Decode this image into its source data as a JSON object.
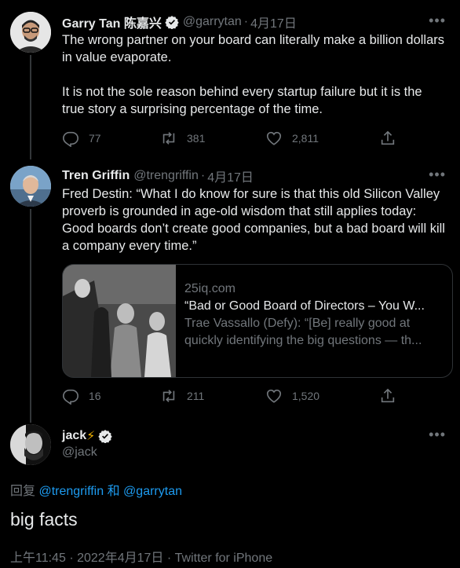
{
  "tweets": [
    {
      "name": "Garry Tan 陈嘉兴",
      "handle": "@garrytan",
      "dot": "·",
      "date": "4月17日",
      "text": "The wrong partner on your board can literally make a billion dollars in value evaporate.\n\nIt is not the sole reason behind every startup failure but it is the true story a surprising percentage of the time.",
      "replies": "77",
      "retweets": "381",
      "likes": "2,811"
    },
    {
      "name": "Tren Griffin",
      "handle": "@trengriffin",
      "dot": "·",
      "date": "4月17日",
      "text": "Fred Destin: “What I do know for sure is that this old Silicon Valley proverb is grounded in age-old wisdom that still applies today: Good boards don’t create good companies, but a bad board will kill a company every time.”",
      "card": {
        "domain": "25iq.com",
        "title": "“Bad or Good Board of Directors – You W...",
        "description": " Trae Vassallo (Defy): “[Be] really good at quickly identifying the big questions — th..."
      },
      "replies": "16",
      "retweets": "211",
      "likes": "1,520"
    }
  ],
  "main_tweet": {
    "name": "jack",
    "emoji": "⚡",
    "handle": "@jack",
    "reply_prefix": "回复",
    "reply_user1": "@trengriffin",
    "reply_and": "和",
    "reply_user2": "@garrytan",
    "text": "big facts",
    "time": "上午11:45",
    "dot": "·",
    "date": "2022年4月17日",
    "source": "Twitter for iPhone"
  },
  "icons": {
    "more": "more-dots-icon",
    "reply": "reply-icon",
    "retweet": "retweet-icon",
    "like": "heart-icon",
    "share": "share-icon",
    "verified": "verified-badge-icon"
  },
  "colors": {
    "background": "#000000",
    "text": "#e7e9ea",
    "muted": "#71767b",
    "link": "#1d9bf0"
  }
}
